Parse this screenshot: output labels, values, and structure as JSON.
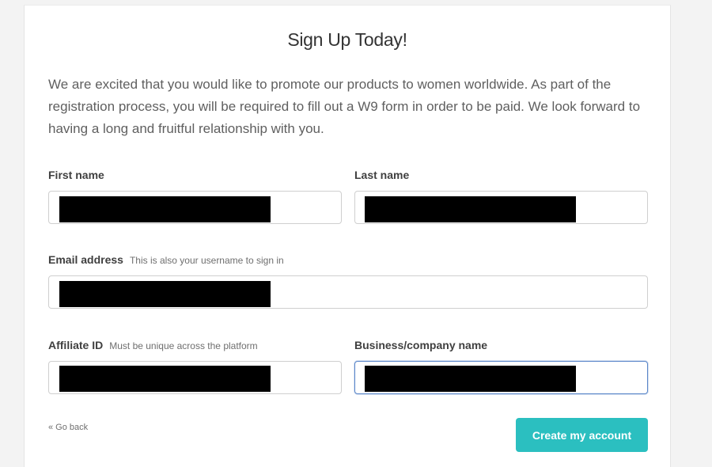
{
  "page": {
    "title": "Sign Up Today!",
    "intro": "We are excited that you would like to promote our products to women worldwide. As part of the registration process, you will be required to fill out a W9 form in order to be paid. We look forward to having a long and fruitful relationship with you."
  },
  "form": {
    "first_name": {
      "label": "First name",
      "value": ""
    },
    "last_name": {
      "label": "Last name",
      "value": ""
    },
    "email": {
      "label": "Email address",
      "hint": "This is also your username to sign in",
      "value": ""
    },
    "affiliate_id": {
      "label": "Affiliate ID",
      "hint": "Must be unique across the platform",
      "value": ""
    },
    "business_name": {
      "label": "Business/company name",
      "value": ""
    }
  },
  "actions": {
    "go_back": "« Go back",
    "submit": "Create my account"
  },
  "colors": {
    "accent": "#2bbfc0",
    "focus_border": "#5a86c9",
    "redaction": "#000000"
  }
}
